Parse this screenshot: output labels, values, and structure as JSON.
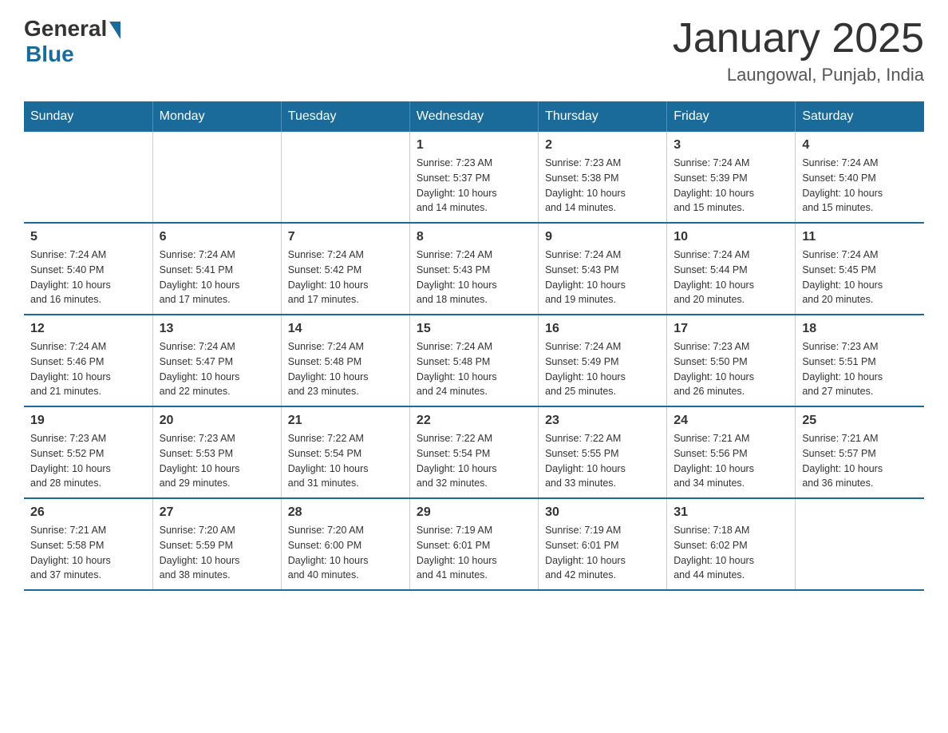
{
  "header": {
    "logo_general": "General",
    "logo_blue": "Blue",
    "month_year": "January 2025",
    "location": "Laungowal, Punjab, India"
  },
  "days_of_week": [
    "Sunday",
    "Monday",
    "Tuesday",
    "Wednesday",
    "Thursday",
    "Friday",
    "Saturday"
  ],
  "weeks": [
    [
      {
        "day": "",
        "info": ""
      },
      {
        "day": "",
        "info": ""
      },
      {
        "day": "",
        "info": ""
      },
      {
        "day": "1",
        "info": "Sunrise: 7:23 AM\nSunset: 5:37 PM\nDaylight: 10 hours\nand 14 minutes."
      },
      {
        "day": "2",
        "info": "Sunrise: 7:23 AM\nSunset: 5:38 PM\nDaylight: 10 hours\nand 14 minutes."
      },
      {
        "day": "3",
        "info": "Sunrise: 7:24 AM\nSunset: 5:39 PM\nDaylight: 10 hours\nand 15 minutes."
      },
      {
        "day": "4",
        "info": "Sunrise: 7:24 AM\nSunset: 5:40 PM\nDaylight: 10 hours\nand 15 minutes."
      }
    ],
    [
      {
        "day": "5",
        "info": "Sunrise: 7:24 AM\nSunset: 5:40 PM\nDaylight: 10 hours\nand 16 minutes."
      },
      {
        "day": "6",
        "info": "Sunrise: 7:24 AM\nSunset: 5:41 PM\nDaylight: 10 hours\nand 17 minutes."
      },
      {
        "day": "7",
        "info": "Sunrise: 7:24 AM\nSunset: 5:42 PM\nDaylight: 10 hours\nand 17 minutes."
      },
      {
        "day": "8",
        "info": "Sunrise: 7:24 AM\nSunset: 5:43 PM\nDaylight: 10 hours\nand 18 minutes."
      },
      {
        "day": "9",
        "info": "Sunrise: 7:24 AM\nSunset: 5:43 PM\nDaylight: 10 hours\nand 19 minutes."
      },
      {
        "day": "10",
        "info": "Sunrise: 7:24 AM\nSunset: 5:44 PM\nDaylight: 10 hours\nand 20 minutes."
      },
      {
        "day": "11",
        "info": "Sunrise: 7:24 AM\nSunset: 5:45 PM\nDaylight: 10 hours\nand 20 minutes."
      }
    ],
    [
      {
        "day": "12",
        "info": "Sunrise: 7:24 AM\nSunset: 5:46 PM\nDaylight: 10 hours\nand 21 minutes."
      },
      {
        "day": "13",
        "info": "Sunrise: 7:24 AM\nSunset: 5:47 PM\nDaylight: 10 hours\nand 22 minutes."
      },
      {
        "day": "14",
        "info": "Sunrise: 7:24 AM\nSunset: 5:48 PM\nDaylight: 10 hours\nand 23 minutes."
      },
      {
        "day": "15",
        "info": "Sunrise: 7:24 AM\nSunset: 5:48 PM\nDaylight: 10 hours\nand 24 minutes."
      },
      {
        "day": "16",
        "info": "Sunrise: 7:24 AM\nSunset: 5:49 PM\nDaylight: 10 hours\nand 25 minutes."
      },
      {
        "day": "17",
        "info": "Sunrise: 7:23 AM\nSunset: 5:50 PM\nDaylight: 10 hours\nand 26 minutes."
      },
      {
        "day": "18",
        "info": "Sunrise: 7:23 AM\nSunset: 5:51 PM\nDaylight: 10 hours\nand 27 minutes."
      }
    ],
    [
      {
        "day": "19",
        "info": "Sunrise: 7:23 AM\nSunset: 5:52 PM\nDaylight: 10 hours\nand 28 minutes."
      },
      {
        "day": "20",
        "info": "Sunrise: 7:23 AM\nSunset: 5:53 PM\nDaylight: 10 hours\nand 29 minutes."
      },
      {
        "day": "21",
        "info": "Sunrise: 7:22 AM\nSunset: 5:54 PM\nDaylight: 10 hours\nand 31 minutes."
      },
      {
        "day": "22",
        "info": "Sunrise: 7:22 AM\nSunset: 5:54 PM\nDaylight: 10 hours\nand 32 minutes."
      },
      {
        "day": "23",
        "info": "Sunrise: 7:22 AM\nSunset: 5:55 PM\nDaylight: 10 hours\nand 33 minutes."
      },
      {
        "day": "24",
        "info": "Sunrise: 7:21 AM\nSunset: 5:56 PM\nDaylight: 10 hours\nand 34 minutes."
      },
      {
        "day": "25",
        "info": "Sunrise: 7:21 AM\nSunset: 5:57 PM\nDaylight: 10 hours\nand 36 minutes."
      }
    ],
    [
      {
        "day": "26",
        "info": "Sunrise: 7:21 AM\nSunset: 5:58 PM\nDaylight: 10 hours\nand 37 minutes."
      },
      {
        "day": "27",
        "info": "Sunrise: 7:20 AM\nSunset: 5:59 PM\nDaylight: 10 hours\nand 38 minutes."
      },
      {
        "day": "28",
        "info": "Sunrise: 7:20 AM\nSunset: 6:00 PM\nDaylight: 10 hours\nand 40 minutes."
      },
      {
        "day": "29",
        "info": "Sunrise: 7:19 AM\nSunset: 6:01 PM\nDaylight: 10 hours\nand 41 minutes."
      },
      {
        "day": "30",
        "info": "Sunrise: 7:19 AM\nSunset: 6:01 PM\nDaylight: 10 hours\nand 42 minutes."
      },
      {
        "day": "31",
        "info": "Sunrise: 7:18 AM\nSunset: 6:02 PM\nDaylight: 10 hours\nand 44 minutes."
      },
      {
        "day": "",
        "info": ""
      }
    ]
  ]
}
